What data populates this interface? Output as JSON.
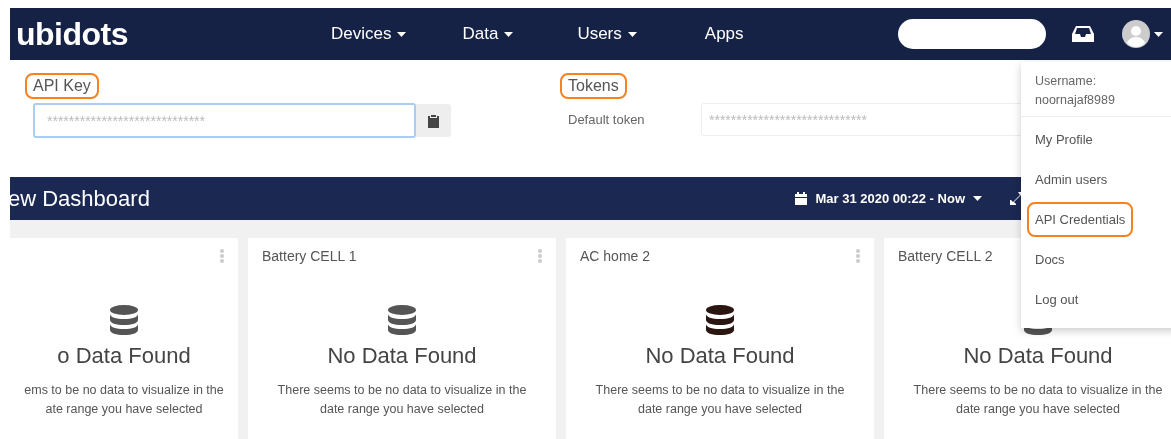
{
  "navbar": {
    "logo": "ubidots",
    "menu": [
      {
        "label": "Devices",
        "caret": true
      },
      {
        "label": "Data",
        "caret": true
      },
      {
        "label": "Users",
        "caret": true
      },
      {
        "label": "Apps",
        "caret": false
      }
    ]
  },
  "api_key": {
    "label": "API Key",
    "highlighted": true,
    "value": "*****************************"
  },
  "tokens": {
    "label": "Tokens",
    "highlighted": true,
    "default_label": "Default token",
    "value": "*****************************"
  },
  "dashboard": {
    "title": "ew Dashboard",
    "date_range": "Mar 31 2020 00:22 - Now"
  },
  "cards": [
    {
      "menu": true,
      "color": "#555555",
      "heading": "o Data Found",
      "message": [
        "ems to be no data to visualize in the",
        "ate range you have selected"
      ]
    },
    {
      "title": "Battery CELL 1",
      "menu": true,
      "color": "#555555",
      "heading": "No Data Found",
      "message": [
        "There seems to be no data to visualize in the",
        "date range you have selected"
      ]
    },
    {
      "title": "AC home 2",
      "menu": true,
      "color": "#2a1510",
      "heading": "No Data Found",
      "message": [
        "There seems to be no data to visualize in the",
        "date range you have selected"
      ]
    },
    {
      "title": "Battery CELL 2",
      "color": "#555555",
      "heading": "No Data Found",
      "message": [
        "There seems to be no data to visualize in the",
        "date range you have selected"
      ]
    }
  ],
  "user_menu": {
    "username_label": "Username:",
    "username": "noornajaf8989",
    "items": [
      {
        "label": "My Profile",
        "highlighted": false
      },
      {
        "label": "Admin users",
        "highlighted": false
      },
      {
        "label": "API Credentials",
        "highlighted": true
      },
      {
        "label": "Docs",
        "highlighted": false
      },
      {
        "label": "Log out",
        "highlighted": false
      }
    ]
  }
}
